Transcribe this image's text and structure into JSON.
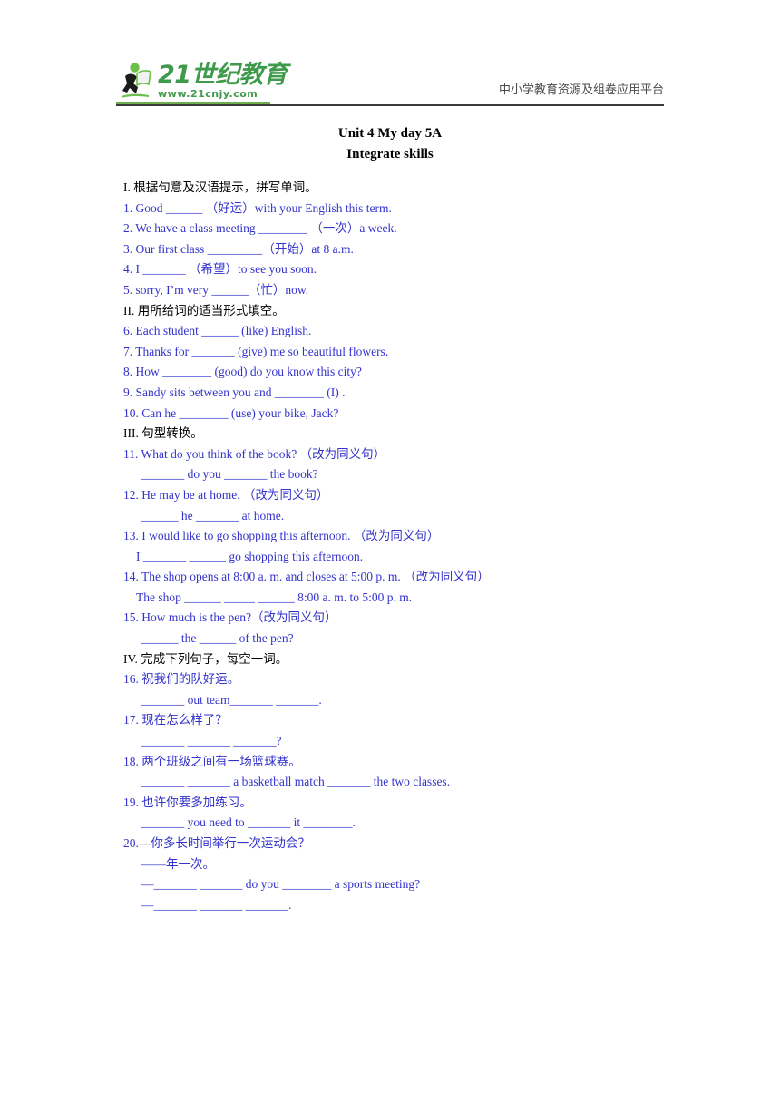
{
  "header": {
    "logo_main": "21世纪教育",
    "logo_sub": "www.21cnjy.com",
    "logo_icon": "running-person-with-book-icon",
    "tagline": "中小学教育资源及组卷应用平台",
    "brand_green": "#3f9a4c"
  },
  "title": {
    "line1": "Unit 4 My day 5A",
    "line2": "Integrate skills"
  },
  "colors": {
    "answer_blue": "#3333cc",
    "heading_black": "#000000"
  },
  "sections": [
    {
      "heading": "I. 根据句意及汉语提示，拼写单词。",
      "items": [
        {
          "q": "1. Good ______ （好运）with your English this term."
        },
        {
          "q": "2. We have a class meeting ________ （一次）a week."
        },
        {
          "q": "3. Our first class _________（开始）at 8 a.m."
        },
        {
          "q": "4. I _______ （希望）to see you soon."
        },
        {
          "q": "5. sorry, I’m very ______（忙）now."
        }
      ]
    },
    {
      "heading": "II. 用所给词的适当形式填空。",
      "items": [
        {
          "q": "6. Each student ______ (like) English."
        },
        {
          "q": "7. Thanks for _______ (give) me so beautiful flowers."
        },
        {
          "q": "8. How ________ (good) do you know this city?"
        },
        {
          "q": "9. Sandy sits between you and ________ (I) ."
        },
        {
          "q": "10. Can he ________ (use) your bike, Jack?"
        }
      ]
    },
    {
      "heading": "III. 句型转换。",
      "items": [
        {
          "q": "11. What do you think of the book?  （改为同义句）",
          "a": "_______ do you _______ the book?"
        },
        {
          "q": "12. He may be at home.  （改为同义句）",
          "a": "______ he _______ at home."
        },
        {
          "q": "13. I would like to go shopping this afternoon.  （改为同义句）",
          "a": "I _______ ______ go shopping    this afternoon."
        },
        {
          "q": "14. The shop opens at 8:00 a. m. and closes at 5:00 p. m.  （改为同义句）",
          "a": "The shop ______ _____ ______ 8:00 a. m.    to 5:00 p. m."
        },
        {
          "q": "15. How much is the pen?（改为同义句）",
          "a": "______ the ______ of the pen?"
        }
      ]
    },
    {
      "heading": "IV. 完成下列句子，每空一词。",
      "items": [
        {
          "q": "16. 祝我们的队好运。",
          "a": "_______ out team_______ _______."
        },
        {
          "q": "17. 现在怎么样了？",
          "a": "_______ _______ _______?"
        },
        {
          "q": "18. 两个班级之间有一场篮球赛。",
          "a": "_______ _______ a basketball match _______ the two classes."
        },
        {
          "q": "19. 也许你要多加练习。",
          "a": "_______ you need to _______ it ________."
        },
        {
          "q": "20.—你多长时间举行一次运动会？",
          "a": "——年一次。",
          "a2": "—_______ _______ do you ________ a sports meeting?",
          "a3": "—_______ _______ _______."
        }
      ]
    }
  ]
}
